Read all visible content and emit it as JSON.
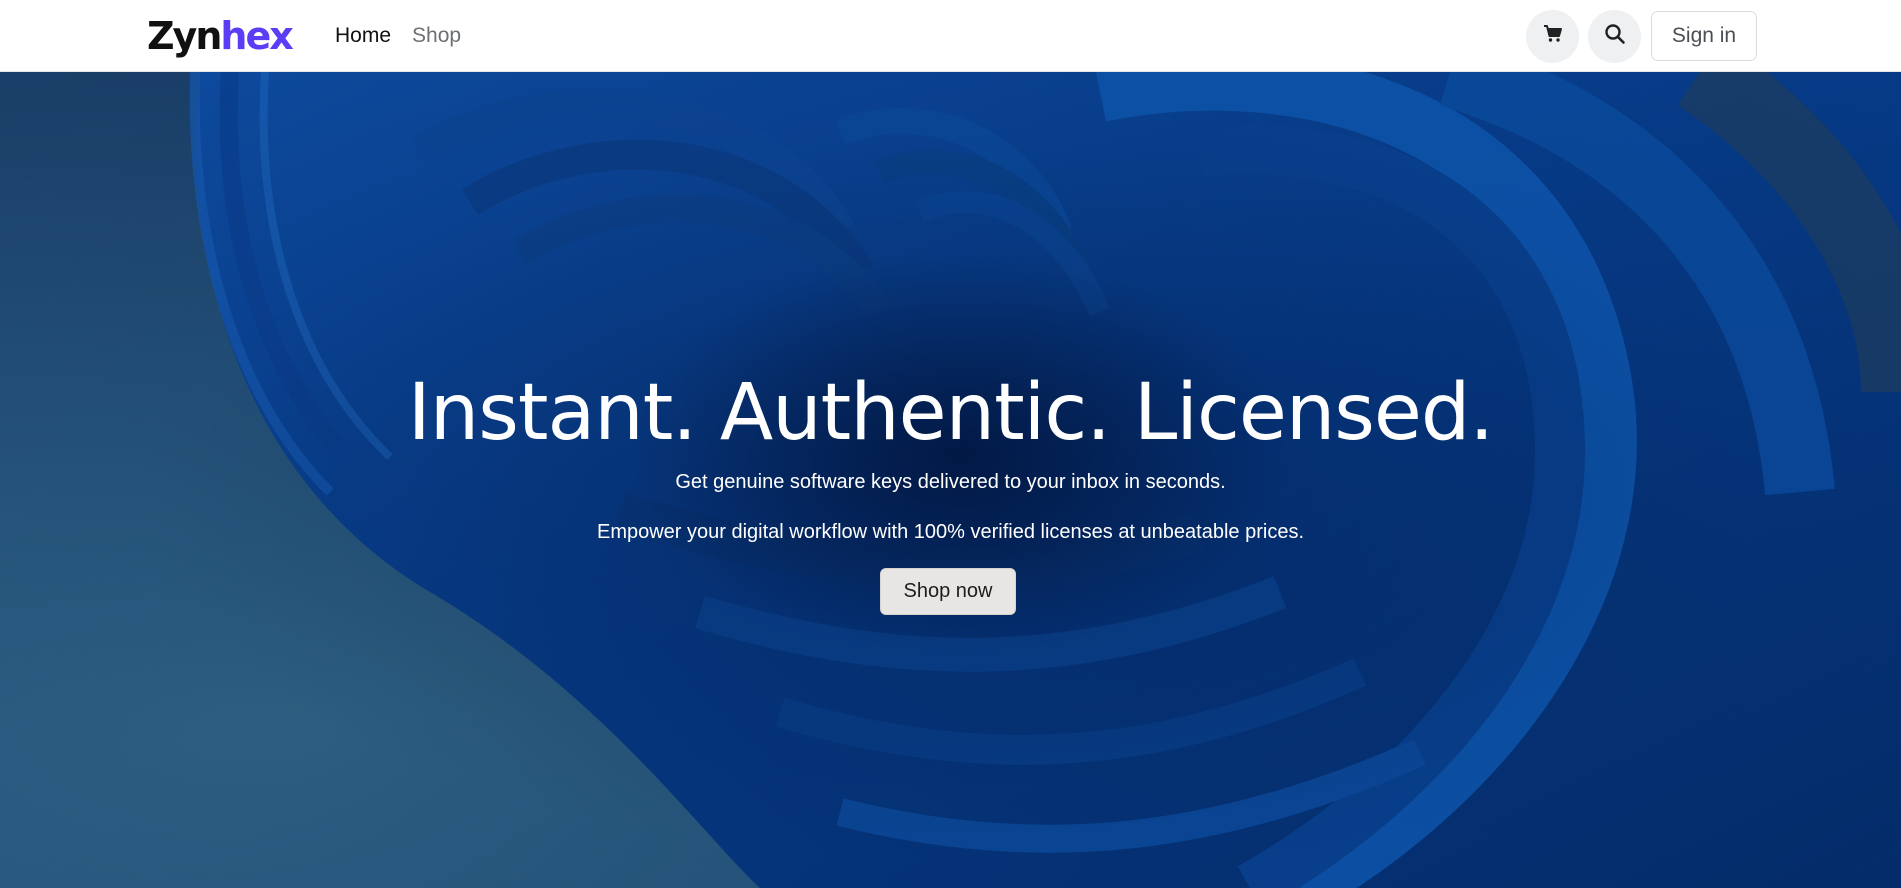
{
  "brand": {
    "logo_part1": "Zyn",
    "logo_part2": "hex",
    "accent_color": "#5b3df5"
  },
  "nav": {
    "links": [
      {
        "label": "Home",
        "active": true
      },
      {
        "label": "Shop",
        "active": false
      }
    ],
    "icons": [
      "cart-icon",
      "search-icon"
    ],
    "signin_label": "Sign in"
  },
  "hero": {
    "title": "Instant. Authentic. Licensed.",
    "subtitle_1": "Get genuine software keys delivered to your inbox in seconds.",
    "subtitle_2": "Empower your digital workflow with 100% verified licenses at unbeatable prices.",
    "cta_label": "Shop now",
    "background_colors": [
      "#1a3f68",
      "#2e6386",
      "#0b3a8a"
    ]
  }
}
